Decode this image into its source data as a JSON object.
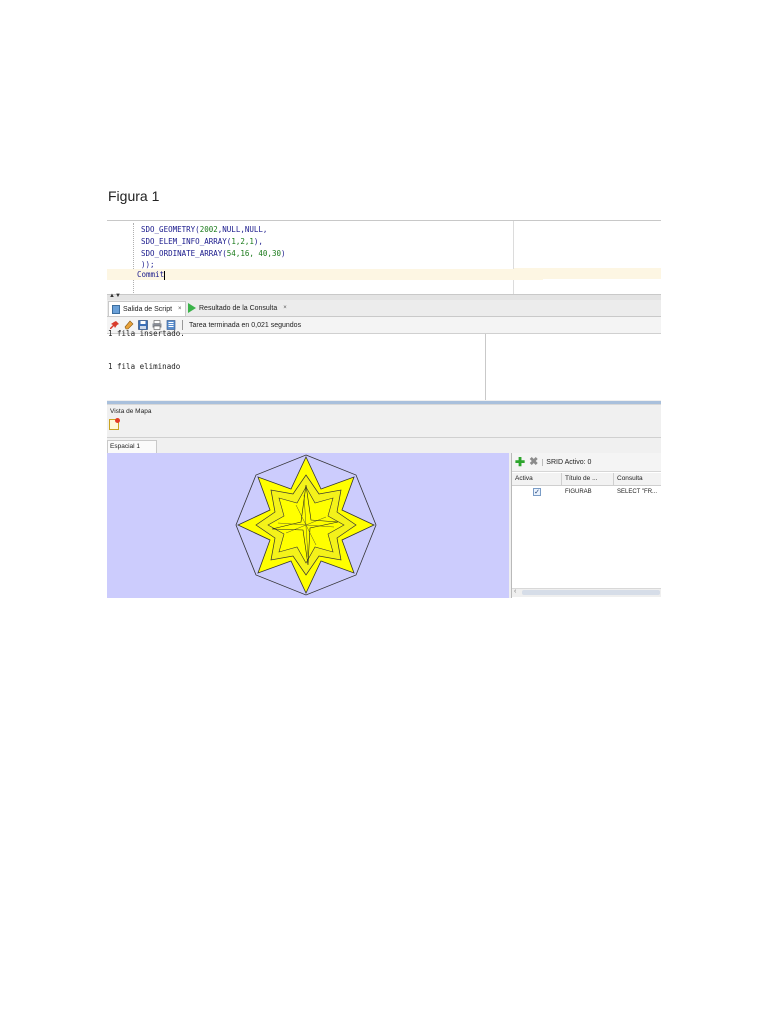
{
  "page": {
    "figure_label": "Figura 1"
  },
  "editor": {
    "lines": [
      {
        "prefix": "SDO_GEOMETRY(",
        "args": "2002",
        "suffix": ",NULL,NULL,"
      },
      {
        "prefix": "SDO_ELEM_INFO_ARRAY(",
        "args": "1,2,1",
        "suffix": "),"
      },
      {
        "prefix": "SDO_ORDINATE_ARRAY(",
        "args": "54,16, 40,30",
        "suffix": ")"
      },
      {
        "prefix": "));",
        "args": "",
        "suffix": ""
      }
    ],
    "current_line": "Commit"
  },
  "tabs": {
    "script_output": "Salida de Script",
    "query_result": "Resultado de la Consulta",
    "close_symbol": "×"
  },
  "toolbar": {
    "status": "Tarea terminada en 0,021 segundos"
  },
  "output": {
    "cut_line": "1 fila insertado.",
    "line": "1 fila eliminado"
  },
  "map_view": {
    "title": "Vista de Mapa",
    "tab_label": "Espacial 1",
    "fill_color": "#ffff00",
    "background_color": "#ccccfd"
  },
  "layers_panel": {
    "srid_label": "SRID Activo: 0",
    "columns": [
      "Activa",
      "Título de ...",
      "Consulta"
    ],
    "rows": [
      {
        "active": true,
        "title": "FIGURAB",
        "query": "SELECT \"FR..."
      }
    ]
  }
}
